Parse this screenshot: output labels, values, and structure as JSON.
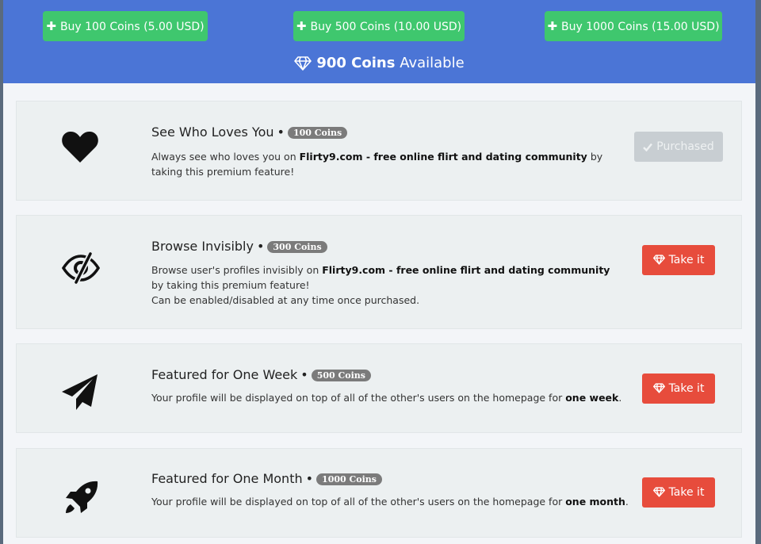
{
  "header": {
    "buy_buttons": [
      {
        "label": "Buy 100 Coins (5.00 USD)",
        "icon": "plus-icon"
      },
      {
        "label": "Buy 500 Coins (10.00 USD)",
        "icon": "plus-icon"
      },
      {
        "label": "Buy 1000 Coins (15.00 USD)",
        "icon": "plus-icon"
      }
    ],
    "coins_count": "900 Coins",
    "coins_suffix": "Available",
    "coins_icon": "diamond-icon"
  },
  "features": [
    {
      "icon": "heart-icon",
      "title": "See Who Loves You",
      "badge": "100 Coins",
      "desc_prefix": "Always see who loves you on ",
      "desc_bold": "Flirty9.com - free online flirt and dating community",
      "desc_suffix": " by taking this premium feature!",
      "desc_line2": "",
      "action_label": "Purchased",
      "action_state": "purchased"
    },
    {
      "icon": "eye-slash-icon",
      "title": "Browse Invisibly",
      "badge": "300 Coins",
      "desc_prefix": "Browse user's profiles invisibly on ",
      "desc_bold": "Flirty9.com - free online flirt and dating community",
      "desc_suffix": " by taking this premium feature!",
      "desc_line2": "Can be enabled/disabled at any time once purchased.",
      "action_label": "Take it",
      "action_state": "available"
    },
    {
      "icon": "paper-plane-icon",
      "title": "Featured for One Week",
      "badge": "500 Coins",
      "desc_prefix": "Your profile will be displayed on top of all of the other's users on the homepage for ",
      "desc_bold": "one week",
      "desc_suffix": ".",
      "desc_line2": "",
      "action_label": "Take it",
      "action_state": "available"
    },
    {
      "icon": "rocket-icon",
      "title": "Featured for One Month",
      "badge": "1000 Coins",
      "desc_prefix": "Your profile will be displayed on top of all of the other's users on the homepage for ",
      "desc_bold": "one month",
      "desc_suffix": ".",
      "desc_line2": "",
      "action_label": "Take it",
      "action_state": "available"
    }
  ],
  "separator": "•",
  "colors": {
    "header_bg": "#4b75d6",
    "buy_green": "#3fc76e",
    "take_red": "#e74c3c",
    "purchased_gray": "#c8ced2",
    "badge_gray": "#7b7b7b"
  }
}
